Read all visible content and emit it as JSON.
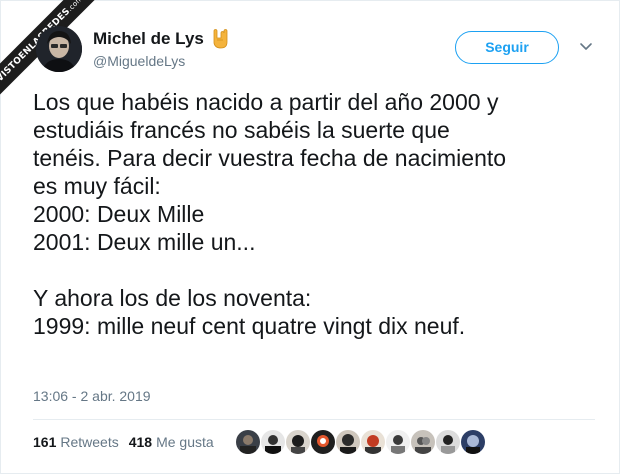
{
  "watermark": {
    "text": "VISTOENLASREDES",
    "domain": ".com"
  },
  "user": {
    "name": "Michel de Lys",
    "handle": "@MigueldeLys",
    "emoji_icon": "sign-of-the-horns-emoji-icon"
  },
  "follow": {
    "label": "Seguir"
  },
  "menu": {
    "icon": "chevron-down-icon"
  },
  "tweet": {
    "text": "Los que habéis nacido a partir del año 2000 y\nestudiáis francés no sabéis la suerte que\ntenéis. Para decir vuestra fecha de nacimiento\nes muy fácil:\n2000: Deux Mille\n2001: Deux mille un...\n\nY ahora los de los noventa:\n1999: mille neuf cent quatre vingt dix neuf.",
    "timestamp": "13:06 - 2 abr. 2019"
  },
  "stats": {
    "retweets_count": "161",
    "retweets_label": "Retweets",
    "likes_count": "418",
    "likes_label": "Me gusta"
  },
  "colors": {
    "accent": "#1da1f2",
    "secondary_text": "#657786",
    "divider": "#e6ecf0"
  }
}
